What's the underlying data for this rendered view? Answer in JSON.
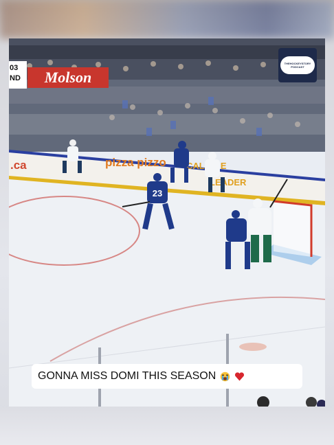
{
  "caption": {
    "text": "GONNA MISS DOMI THIS SEASON"
  },
  "scoreboard": {
    "line1": "03",
    "line2": "ND"
  },
  "logo": {
    "text": "THEHOCKEYSTORY PODCAST"
  },
  "rink_ads": {
    "molson": "Molson",
    "ca": ".ca",
    "pizza": "pizza pizzo",
    "callme": "CALL-ME",
    "leader": "LEADER"
  },
  "players": {
    "jersey_number": "23"
  },
  "icons": {
    "crying_emoji": "loudly-crying-face-icon",
    "heart_emoji": "red-heart-icon"
  },
  "colors": {
    "leafs_blue": "#1f3a8a",
    "canucks_white": "#f4f6f8",
    "caption_bg": "#ffffff"
  }
}
